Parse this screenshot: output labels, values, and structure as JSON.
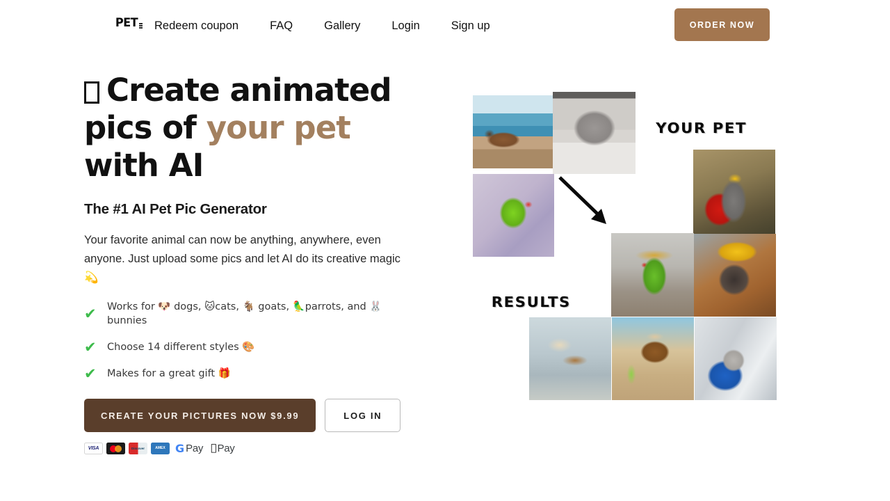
{
  "header": {
    "logo": {
      "text": "PET",
      "dots": 3
    },
    "nav": [
      {
        "label": "Redeem coupon"
      },
      {
        "label": "FAQ"
      },
      {
        "label": "Gallery"
      },
      {
        "label": "Login"
      },
      {
        "label": "Sign up"
      }
    ],
    "order_button": {
      "label": "ORDER NOW",
      "bg": "#a3764f",
      "color": "#ffffff"
    }
  },
  "hero": {
    "title_prefix_glyph": "□",
    "title_part1": "Create animated pics of ",
    "title_accent": "your pet",
    "title_part2": " with AI",
    "title_accent_color": "#a3805f",
    "subtitle": "The #1 AI Pet Pic Generator",
    "description": "Your favorite animal can now be anything, anywhere, even anyone. Just upload some pics and let AI do its creative magic 💫",
    "features": [
      {
        "check": "✔",
        "text_parts": [
          "Works for ",
          "🐶",
          " dogs, ",
          "🐱",
          "cats, ",
          "🐐",
          " goats, ",
          "🦜",
          "parrots, and ",
          "🐰",
          "bunnies"
        ]
      },
      {
        "check": "✔",
        "text_parts": [
          "Choose 14 different styles ",
          "🎨"
        ]
      },
      {
        "check": "✔",
        "text_parts": [
          "Makes for a great gift ",
          "🎁"
        ]
      }
    ],
    "primary_button": {
      "label": "CREATE YOUR PICTURES NOW $9.99",
      "bg": "#5a3e2b"
    },
    "secondary_button": {
      "label": "LOG IN"
    },
    "payments": [
      {
        "name": "visa",
        "label": "VISA"
      },
      {
        "name": "mastercard",
        "label": ""
      },
      {
        "name": "discover",
        "label": "DISCOVER NETWORK"
      },
      {
        "name": "amex",
        "label": "AMEX"
      },
      {
        "name": "google-pay",
        "label": "Pay",
        "mark": "G"
      },
      {
        "name": "apple-pay",
        "label": "Pay",
        "mark": ""
      }
    ]
  },
  "collage": {
    "label_your_pet": "YOUR PET",
    "label_results": "RESULTS",
    "source_photos": [
      {
        "name": "dog-on-beach",
        "caption": "Brown dog walking on the beach"
      },
      {
        "name": "gray-cat",
        "caption": "Gray british shorthair cat on carpet"
      },
      {
        "name": "green-parrot",
        "caption": "Green ringneck parrot on sofa"
      }
    ],
    "result_photos": [
      {
        "name": "cat-king",
        "caption": "Gray cat wearing gold crown and red cape"
      },
      {
        "name": "parrot-king",
        "caption": "Green parrot with golden wings and crown"
      },
      {
        "name": "dog-beret",
        "caption": "Dog wearing yellow beret"
      },
      {
        "name": "dog-flying",
        "caption": "Dog with wings flying in the sky"
      },
      {
        "name": "dog-beach-hat",
        "caption": "Dog with sun hat and sunglasses at the beach"
      },
      {
        "name": "cat-astronaut",
        "caption": "Cat in astronaut suit inside spacecraft"
      }
    ]
  }
}
